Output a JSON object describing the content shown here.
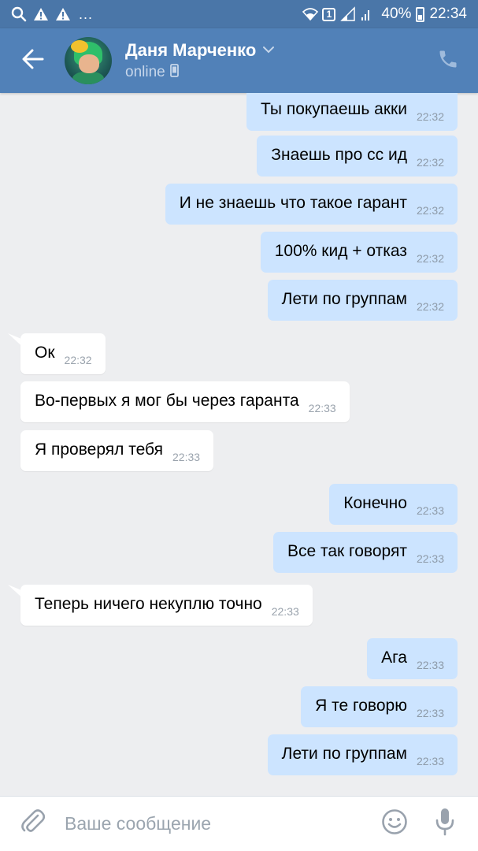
{
  "status_bar": {
    "left_dots": "...",
    "sim_badge": "1",
    "battery": "40%",
    "time": "22:34"
  },
  "header": {
    "name": "Даня Марченко",
    "status": "online"
  },
  "messages": [
    {
      "dir": "out",
      "text": "Ты покупаешь акки",
      "time": "22:32"
    },
    {
      "dir": "out",
      "text": "Знаешь про сс ид",
      "time": "22:32"
    },
    {
      "dir": "out",
      "text": "И не знаешь что такое гарант",
      "time": "22:32"
    },
    {
      "dir": "out",
      "text": "100% кид + отказ",
      "time": "22:32"
    },
    {
      "dir": "out",
      "text": "Лети по группам",
      "time": "22:32"
    },
    {
      "dir": "in",
      "text": "Ок",
      "time": "22:32"
    },
    {
      "dir": "in",
      "text": "Во-первых я мог бы через гаранта",
      "time": "22:33"
    },
    {
      "dir": "in",
      "text": "Я проверял тебя",
      "time": "22:33"
    },
    {
      "dir": "out",
      "text": "Конечно",
      "time": "22:33"
    },
    {
      "dir": "out",
      "text": "Все так говорят",
      "time": "22:33"
    },
    {
      "dir": "in",
      "text": "Теперь ничего некуплю точно",
      "time": "22:33"
    },
    {
      "dir": "out",
      "text": "Ага",
      "time": "22:33"
    },
    {
      "dir": "out",
      "text": "Я те говорю",
      "time": "22:33"
    },
    {
      "dir": "out",
      "text": "Лети по группам",
      "time": "22:33"
    }
  ],
  "composer": {
    "placeholder": "Ваше сообщение"
  },
  "colors": {
    "status_bar": "#4a76a8",
    "header": "#5181b8",
    "outgoing_bubble": "#cce4ff",
    "incoming_bubble": "#ffffff",
    "chat_background": "#edeef0"
  },
  "icons": {
    "status_left": [
      "search-icon",
      "warning-icon",
      "warning-icon"
    ],
    "status_right": [
      "wifi-icon",
      "sim-icon",
      "signal-icon",
      "signal-icon",
      "battery-icon"
    ],
    "header": [
      "back-arrow-icon",
      "chevron-down-icon",
      "mobile-device-icon",
      "phone-icon"
    ],
    "composer": [
      "paperclip-icon",
      "smile-icon",
      "microphone-icon"
    ]
  }
}
